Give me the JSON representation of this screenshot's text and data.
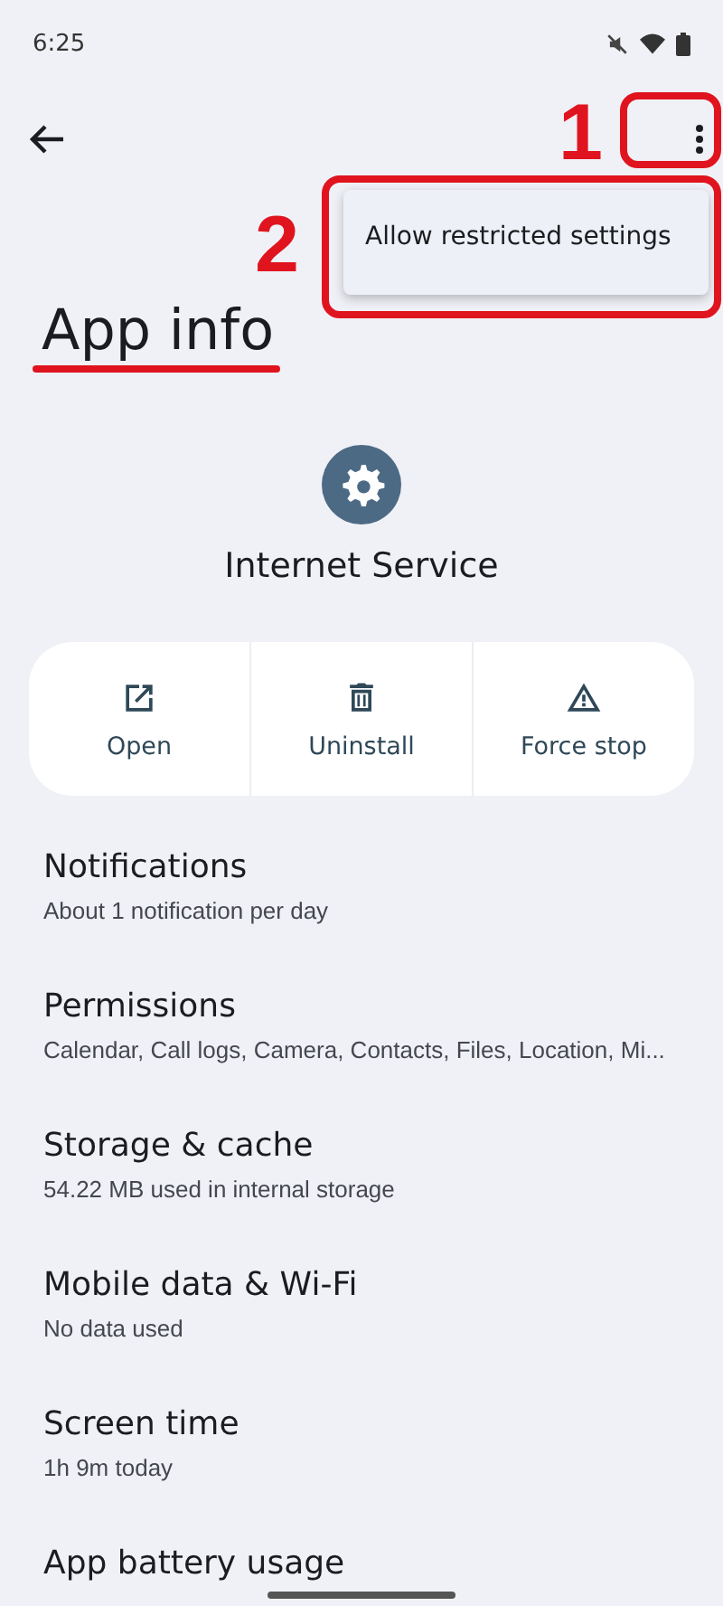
{
  "status_bar": {
    "time": "6:25"
  },
  "menu": {
    "items": [
      "Allow restricted settings"
    ]
  },
  "title": "App info",
  "app": {
    "name": "Internet Service"
  },
  "actions": [
    {
      "label": "Open",
      "kind": "open"
    },
    {
      "label": "Uninstall",
      "kind": "uninstall"
    },
    {
      "label": "Force stop",
      "kind": "stop"
    }
  ],
  "settings": [
    {
      "title": "Notifications",
      "subtitle": "About 1 notification per day"
    },
    {
      "title": "Permissions",
      "subtitle": "Calendar, Call logs, Camera, Contacts, Files, Location, Mi..."
    },
    {
      "title": "Storage & cache",
      "subtitle": "54.22 MB used in internal storage"
    },
    {
      "title": "Mobile data & Wi-Fi",
      "subtitle": "No data used"
    },
    {
      "title": "Screen time",
      "subtitle": "1h 9m today"
    },
    {
      "title": "App battery usage"
    }
  ],
  "annotations": [
    {
      "label": "1"
    },
    {
      "label": "2"
    }
  ]
}
